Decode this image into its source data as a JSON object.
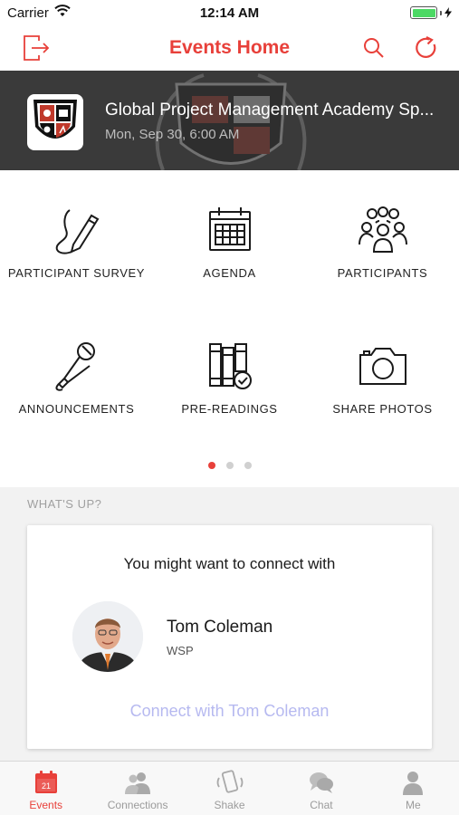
{
  "status_bar": {
    "carrier": "Carrier",
    "time": "12:14 AM",
    "battery_level": 1.0
  },
  "nav": {
    "title": "Events Home",
    "left_icon": "logout-icon",
    "right_icons": [
      "search-icon",
      "refresh-icon"
    ]
  },
  "event": {
    "title": "Global Project Management Academy Sp...",
    "date": "Mon, Sep 30, 6:00 AM"
  },
  "tiles": [
    {
      "label": "PARTICIPANT SURVEY",
      "icon": "pencil-icon"
    },
    {
      "label": "AGENDA",
      "icon": "calendar-icon"
    },
    {
      "label": "PARTICIPANTS",
      "icon": "people-icon"
    },
    {
      "label": "ANNOUNCEMENTS",
      "icon": "microphone-icon"
    },
    {
      "label": "PRE-READINGS",
      "icon": "books-icon"
    },
    {
      "label": "SHARE PHOTOS",
      "icon": "camera-icon"
    }
  ],
  "pager": {
    "pages": 3,
    "active": 1
  },
  "whatsup": {
    "section_label": "WHAT'S UP?",
    "card_heading": "You might want to connect with",
    "person_name": "Tom Coleman",
    "person_company": "WSP",
    "connect_label": "Connect with Tom Coleman"
  },
  "tab_bar": {
    "calendar_day": "21",
    "tabs": [
      {
        "label": "Events",
        "icon": "events-calendar-icon",
        "active": true
      },
      {
        "label": "Connections",
        "icon": "connections-icon",
        "active": false
      },
      {
        "label": "Shake",
        "icon": "shake-phone-icon",
        "active": false
      },
      {
        "label": "Chat",
        "icon": "chat-bubbles-icon",
        "active": false
      },
      {
        "label": "Me",
        "icon": "person-icon",
        "active": false
      }
    ]
  },
  "colors": {
    "accent": "#e8403a",
    "banner_bg": "#3a3a3a",
    "link": "#b6b9f0",
    "battery": "#4cd964"
  }
}
